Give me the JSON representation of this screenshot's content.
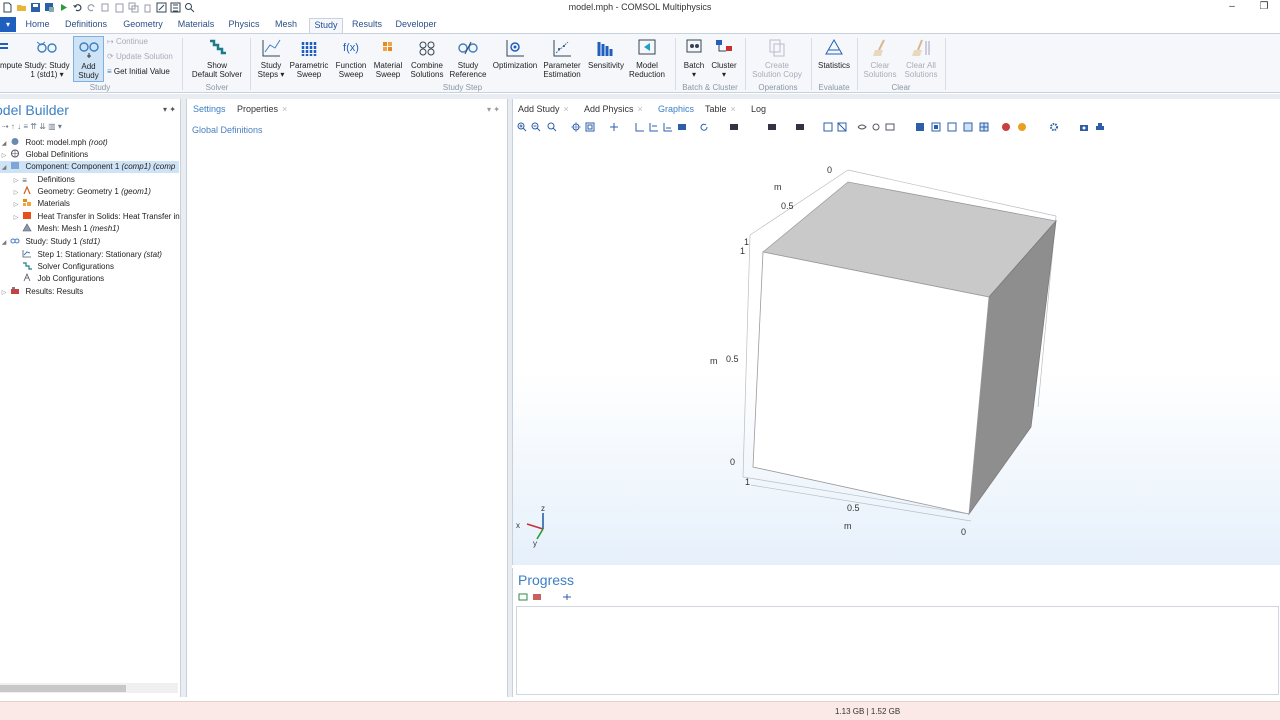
{
  "window": {
    "title": "model.mph - COMSOL Multiphysics",
    "minimize": "–",
    "restore": "❐"
  },
  "file_button": "▾",
  "ribbon_tabs": [
    "Home",
    "Definitions",
    "Geometry",
    "Materials",
    "Physics",
    "Mesh",
    "Study",
    "Results",
    "Developer"
  ],
  "active_tab": "Study",
  "ribbon": {
    "compute": "mpute",
    "study_std1": "Study: Study\n1 (std1) ▾",
    "add_study": "Add\nStudy",
    "continue": "Continue",
    "update_solution": "Update Solution",
    "get_initial_value": "Get Initial Value",
    "show_default_solver": "Show\nDefault Solver",
    "study_steps": "Study\nSteps ▾",
    "parametric_sweep": "Parametric\nSweep",
    "function_sweep": "Function\nSweep",
    "material_sweep": "Material\nSweep",
    "combine_solutions": "Combine\nSolutions",
    "study_reference": "Study\nReference",
    "optimization": "Optimization",
    "parameter_estimation": "Parameter\nEstimation",
    "sensitivity": "Sensitivity",
    "model_reduction": "Model\nReduction",
    "batch": "Batch\n▾",
    "cluster": "Cluster\n▾",
    "create_solution_copy": "Create\nSolution Copy",
    "statistics": "Statistics",
    "clear_solutions": "Clear\nSolutions",
    "clear_all_solutions": "Clear All\nSolutions",
    "function_sweep_icon_text": "f(x)",
    "groups": {
      "study": "Study",
      "solver": "Solver",
      "study_step": "Study Step",
      "batch_cluster": "Batch & Cluster",
      "operations": "Operations",
      "evaluate": "Evaluate",
      "clear": "Clear"
    }
  },
  "model_builder": {
    "title": "odel Builder",
    "pin": "▾ ✦",
    "toolbar": "⇢ ↑ ↓ ≡ ⇈ ⇊ ▥ ▾",
    "tree": [
      {
        "label": "Root: model.mph ",
        "tag": "(root)"
      },
      {
        "label": "Global Definitions",
        "tag": ""
      },
      {
        "label": "Component: Component 1 ",
        "tag": "(comp1) (comp"
      },
      {
        "label": "Definitions",
        "tag": ""
      },
      {
        "label": "Geometry: Geometry 1 ",
        "tag": "(geom1)"
      },
      {
        "label": "Materials",
        "tag": ""
      },
      {
        "label": "Heat Transfer in Solids: Heat Transfer in",
        "tag": ""
      },
      {
        "label": "Mesh: Mesh 1 ",
        "tag": "(mesh1)"
      },
      {
        "label": "Study: Study 1 ",
        "tag": "(std1)"
      },
      {
        "label": "Step 1: Stationary: Stationary ",
        "tag": "(stat)"
      },
      {
        "label": "Solver Configurations",
        "tag": ""
      },
      {
        "label": "Job Configurations",
        "tag": ""
      },
      {
        "label": "Results: Results",
        "tag": ""
      }
    ]
  },
  "settings": {
    "tabs": [
      "Settings",
      "Properties"
    ],
    "close": "×",
    "pin": "▾ ✦",
    "label": "Global Definitions"
  },
  "graphics": {
    "tabs": [
      "Add Study",
      "Add Physics",
      "Graphics",
      "Table",
      "Log"
    ],
    "close": "×",
    "axes": {
      "top_0": "0",
      "top_m": "m",
      "top_05": "0.5",
      "top_1": "1",
      "left_1": "1",
      "left_05": "0.5",
      "left_m": "m",
      "left_0": "0",
      "bottom_1": "1",
      "bottom_05": "0.5",
      "bottom_m": "m",
      "bottom_0": "0"
    },
    "triad": {
      "x": "x",
      "y": "y",
      "z": "z"
    }
  },
  "progress": {
    "title": "Progress"
  },
  "status": {
    "memory": "1.13 GB | 1.52 GB"
  },
  "colors": {
    "accent": "#3b7fc4",
    "ribbon_bg": "#f5f7fa",
    "selected": "#cfe3f7",
    "status_bg": "#fbe9e7"
  }
}
